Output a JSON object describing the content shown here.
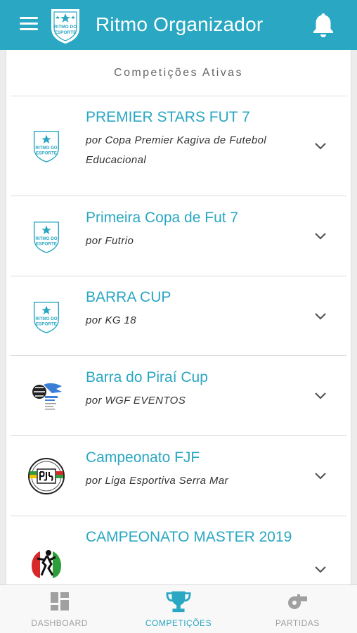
{
  "app": {
    "title": "Ritmo Organizador",
    "logo_text": [
      "RITMO DO",
      "ESPORTE"
    ],
    "accent_color": "#2aa7c2"
  },
  "section": {
    "title": "Competições Ativas"
  },
  "competitions": [
    {
      "name": "PREMIER STARS FUT 7",
      "organizer": "por Copa Premier Kagiva de Futebol Educacional",
      "logo": "ritmo-logo"
    },
    {
      "name": "Primeira Copa de Fut 7",
      "organizer": "por Futrio",
      "logo": "ritmo-logo"
    },
    {
      "name": "BARRA CUP",
      "organizer": "por KG 18",
      "logo": "ritmo-logo"
    },
    {
      "name": "Barra do Piraí Cup",
      "organizer": "por WGF EVENTOS",
      "logo": "barra-cup-logo"
    },
    {
      "name": "Campeonato FJF",
      "organizer": "por Liga Esportiva Serra Mar",
      "logo": "fjf-logo"
    },
    {
      "name": "CAMPEONATO MASTER 2019",
      "organizer": "",
      "logo": "master-logo"
    }
  ],
  "bottom_nav": {
    "dashboard": {
      "label": "DASHBOARD",
      "icon": "dashboard-icon"
    },
    "competicoes": {
      "label": "COMPETIÇÕES",
      "icon": "trophy-icon"
    },
    "partidas": {
      "label": "PARTIDAS",
      "icon": "whistle-icon"
    },
    "active": "competicoes"
  }
}
